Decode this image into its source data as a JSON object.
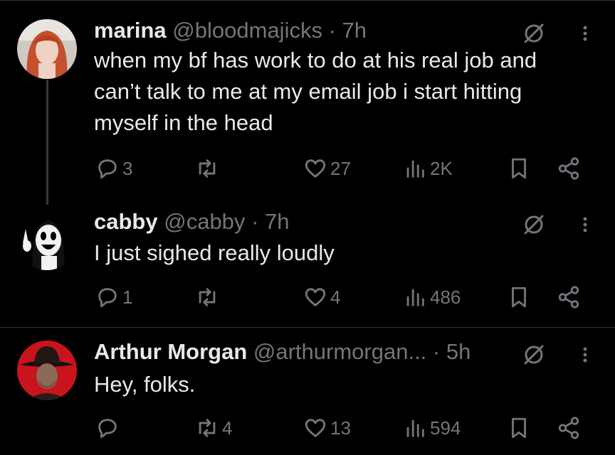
{
  "tweets": [
    {
      "name": "marina",
      "handle": "@bloodmajicks",
      "time": "· 7h",
      "text_lines": [
        "when my bf has work to do at his real job and",
        "can’t talk to me at my email job i start hitting",
        "myself in the head"
      ],
      "replies": "3",
      "reposts": "",
      "likes": "27",
      "views": "2K"
    },
    {
      "name": "cabby",
      "handle": "@cabby",
      "time": "· 7h",
      "text_lines": [
        "I just sighed really loudly"
      ],
      "replies": "1",
      "reposts": "",
      "likes": "4",
      "views": "486"
    },
    {
      "name": "Arthur Morgan",
      "handle": "@arthurmorgan...",
      "time": "· 5h",
      "text_lines": [
        "Hey, folks."
      ],
      "replies": "",
      "reposts": "4",
      "likes": "13",
      "views": "594"
    }
  ],
  "colors": {
    "background": "#000000",
    "text": "#e7e9ea",
    "muted": "#71767b",
    "divider": "#2f3336"
  },
  "icons": [
    "reply-icon",
    "repost-icon",
    "like-icon",
    "views-icon",
    "bookmark-icon",
    "share-icon",
    "grok-icon",
    "more-icon"
  ]
}
